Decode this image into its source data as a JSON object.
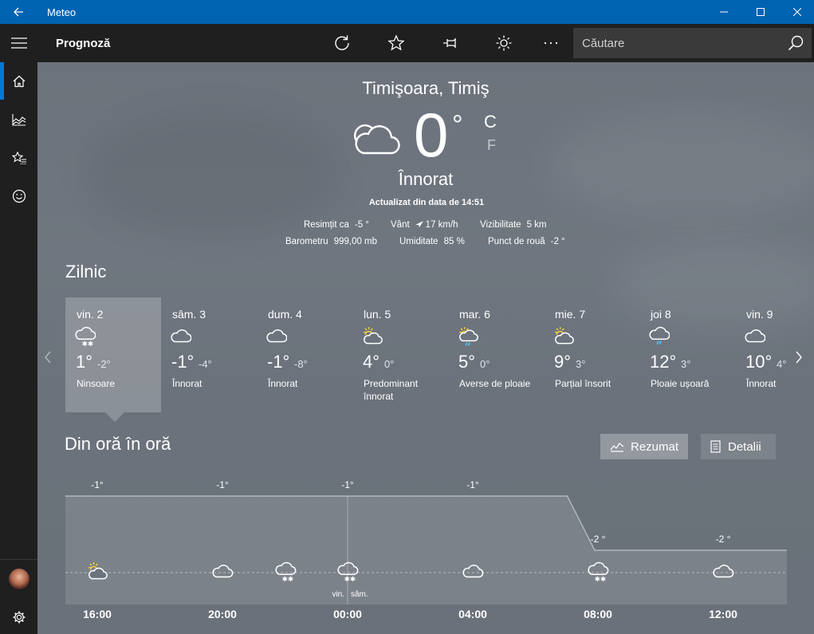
{
  "app": {
    "title": "Meteo"
  },
  "toolbar": {
    "title": "Prognoză",
    "search_placeholder": "Căutare"
  },
  "current": {
    "location": "Timişoara, Timiş",
    "temperature": "0",
    "degree_symbol": "°",
    "unit_c": "C",
    "unit_f": "F",
    "condition": "Înnorat",
    "updated": "Actualizat din data de 14:51",
    "details": {
      "feels_like_label": "Resimțit ca",
      "feels_like": "-5 °",
      "wind_label": "Vânt",
      "wind": "17 km/h",
      "visibility_label": "Vizibilitate",
      "visibility": "5 km",
      "barometer_label": "Barometru",
      "barometer": "999,00 mb",
      "humidity_label": "Umiditate",
      "humidity": "85 %",
      "dew_point_label": "Punct de rouă",
      "dew_point": "-2 °"
    }
  },
  "daily": {
    "title": "Zilnic",
    "days": [
      {
        "name": "vin. 2",
        "hi": "1°",
        "lo": "-2°",
        "desc": "Ninsoare",
        "icon": "snow-cloud-icon"
      },
      {
        "name": "sâm. 3",
        "hi": "-1°",
        "lo": "-4°",
        "desc": "Înnorat",
        "icon": "cloud-icon"
      },
      {
        "name": "dum. 4",
        "hi": "-1°",
        "lo": "-8°",
        "desc": "Înnorat",
        "icon": "cloud-icon"
      },
      {
        "name": "lun. 5",
        "hi": "4°",
        "lo": "0°",
        "desc": "Predominant înnorat",
        "icon": "partly-sunny-icon"
      },
      {
        "name": "mar. 6",
        "hi": "5°",
        "lo": "0°",
        "desc": "Averse de ploaie",
        "icon": "sun-rain-icon"
      },
      {
        "name": "mie. 7",
        "hi": "9°",
        "lo": "3°",
        "desc": "Parțial însorit",
        "icon": "partly-sunny-icon"
      },
      {
        "name": "joi 8",
        "hi": "12°",
        "lo": "3°",
        "desc": "Ploaie ușoară",
        "icon": "rain-cloud-icon"
      },
      {
        "name": "vin. 9",
        "hi": "10°",
        "lo": "4°",
        "desc": "Înnorat",
        "icon": "cloud-icon"
      }
    ]
  },
  "hourly": {
    "title": "Din oră în oră",
    "summary_label": "Rezumat",
    "details_label": "Detalii",
    "day_split": {
      "left": "vin.",
      "right": "sâm."
    },
    "hours": [
      {
        "time": "16:00",
        "temp": "-1°",
        "icon": "partly-sunny-icon"
      },
      {
        "time": "20:00",
        "temp": "-1°",
        "icon": "cloud-icon"
      },
      {
        "time": "00:00",
        "temp": "-1°",
        "icon": "snow-cloud-icon"
      },
      {
        "time": "04:00",
        "temp": "-1°",
        "icon": "cloud-icon"
      },
      {
        "time": "08:00",
        "temp": "-2 °",
        "icon": "snow-cloud-icon"
      },
      {
        "time": "12:00",
        "temp": "-2 °",
        "icon": "cloud-icon"
      }
    ],
    "curve_temps": [
      -1,
      -1,
      -1,
      -1,
      -1,
      -1,
      -1,
      -1,
      -2,
      -2,
      -2,
      -2,
      -2
    ]
  },
  "colors": {
    "titlebar": "#0063b1",
    "sidebar": "#1f1f1f",
    "accent": "#0078d7"
  }
}
